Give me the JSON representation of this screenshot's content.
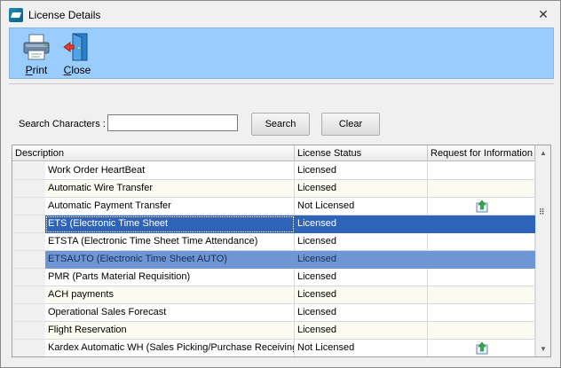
{
  "window": {
    "title": "License Details",
    "close_glyph": "✕"
  },
  "toolbar": {
    "print_label": "Print",
    "print_mnemonic": "P",
    "print_rest": "rint",
    "close_label": "Close",
    "close_mnemonic": "C",
    "close_rest": "lose"
  },
  "search": {
    "label": "Search Characters :",
    "value": "",
    "search_button": "Search",
    "clear_button": "Clear"
  },
  "grid": {
    "columns": [
      "Description",
      "License Status",
      "Request for Information"
    ],
    "rows": [
      {
        "description": "Work Order HeartBeat",
        "status": "Licensed",
        "request_icon": ""
      },
      {
        "description": "Automatic Wire Transfer",
        "status": "Licensed",
        "request_icon": ""
      },
      {
        "description": "Automatic Payment Transfer",
        "status": "Not Licensed",
        "request_icon": "upload-icon"
      },
      {
        "description": "ETS (Electronic Time Sheet",
        "status": "Licensed",
        "request_icon": ""
      },
      {
        "description": "ETSTA (Electronic Time Sheet Time Attendance)",
        "status": "Licensed",
        "request_icon": ""
      },
      {
        "description": "ETSAUTO (Electronic Time Sheet AUTO)",
        "status": "Licensed",
        "request_icon": ""
      },
      {
        "description": "PMR (Parts Material Requisition)",
        "status": "Licensed",
        "request_icon": ""
      },
      {
        "description": "ACH payments",
        "status": "Licensed",
        "request_icon": ""
      },
      {
        "description": "Operational Sales Forecast",
        "status": "Licensed",
        "request_icon": ""
      },
      {
        "description": "Flight Reservation",
        "status": "Licensed",
        "request_icon": ""
      },
      {
        "description": "Kardex Automatic WH (Sales Picking/Purchase Receiving",
        "status": "Not Licensed",
        "request_icon": "upload-icon"
      }
    ]
  },
  "colors": {
    "toolbar_bg": "#99ccff",
    "selected_row": "#2d63b8",
    "secondary_selected_row": "#6f96d4"
  }
}
